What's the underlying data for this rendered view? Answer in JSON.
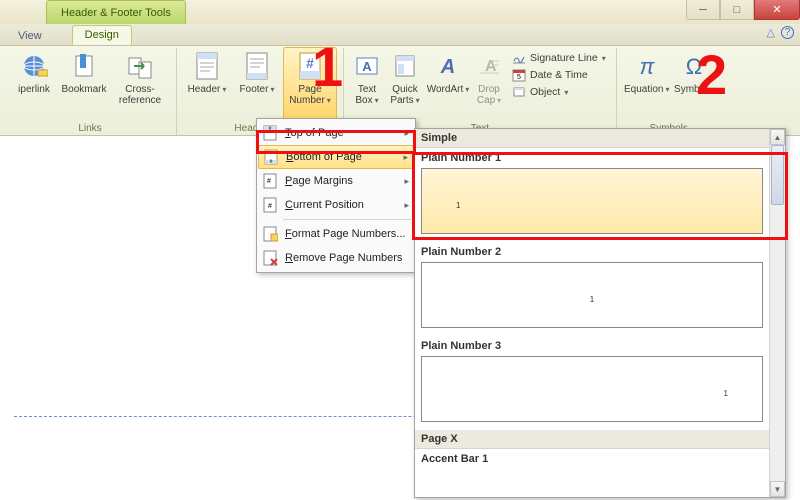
{
  "title": {
    "tools_tab": "Header & Footer Tools"
  },
  "window_buttons": {
    "min": "─",
    "max": "□",
    "close": "✕"
  },
  "tabs": {
    "view": "View",
    "design": "Design"
  },
  "help": {
    "collapse": "△",
    "help": "?"
  },
  "ribbon": {
    "links": {
      "label": "Links",
      "hyperlink": "iperlink",
      "bookmark": "Bookmark",
      "crossref": "Cross-reference"
    },
    "hf": {
      "label": "Header & F",
      "header": "Header",
      "footer": "Footer",
      "pagenum": "Page Number"
    },
    "text": {
      "label": "Text",
      "textbox": "Text Box",
      "quickparts": "Quick Parts",
      "wordart": "WordArt",
      "dropcap": "Drop Cap",
      "sigline": "Signature Line",
      "datetime": "Date & Time",
      "object": "Object"
    },
    "symbols": {
      "label": "Symbols",
      "equation": "Equation",
      "symbol": "Symbol"
    }
  },
  "menu": {
    "top": "Top of Page",
    "bottom": "Bottom of Page",
    "margins": "Page Margins",
    "current": "Current Position",
    "format": "Format Page Numbers...",
    "remove": "Remove Page Numbers"
  },
  "gallery": {
    "header": "Simple",
    "items": [
      {
        "label": "Plain Number 1",
        "num": "1",
        "pos": "left"
      },
      {
        "label": "Plain Number 2",
        "num": "1",
        "pos": "center"
      },
      {
        "label": "Plain Number 3",
        "num": "1",
        "pos": "right"
      }
    ],
    "section2": "Page X",
    "item4": "Accent Bar 1"
  },
  "annotations": {
    "one": "1",
    "two": "2"
  }
}
